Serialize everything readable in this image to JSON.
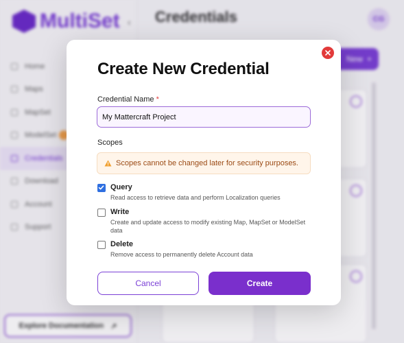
{
  "app": {
    "brand": "MultiSet",
    "page_title": "Credentials",
    "avatar_initials": "CG",
    "new_button_label": "New",
    "explore_label": "Explore Documentation",
    "nav": [
      {
        "label": "Home",
        "icon": "home-icon"
      },
      {
        "label": "Maps",
        "icon": "map-icon"
      },
      {
        "label": "MapSet",
        "icon": "mapset-icon"
      },
      {
        "label": "ModelSet",
        "icon": "modelset-icon"
      },
      {
        "label": "Credentials",
        "icon": "key-icon",
        "active": true
      },
      {
        "label": "Download",
        "icon": "download-icon"
      },
      {
        "label": "Account",
        "icon": "account-icon"
      },
      {
        "label": "Support",
        "icon": "support-icon"
      }
    ]
  },
  "modal": {
    "title": "Create New Credential",
    "name_label": "Credential Name",
    "required_marker": "*",
    "name_value": "My Mattercraft Project",
    "scopes_label": "Scopes",
    "warning_text": "Scopes cannot be changed later for security purposes.",
    "scopes": [
      {
        "name": "Query",
        "checked": true,
        "description": "Read access to retrieve data and perform Localization queries"
      },
      {
        "name": "Write",
        "checked": false,
        "description": "Create and update access to modify existing Map, MapSet or ModelSet data"
      },
      {
        "name": "Delete",
        "checked": false,
        "description": "Remove access to permanently delete Account data"
      }
    ],
    "cancel_label": "Cancel",
    "create_label": "Create"
  },
  "colors": {
    "accent": "#7a2fcc",
    "close": "#e23a3a",
    "checkbox": "#2f6fe0",
    "warning_bg": "#fff5ea",
    "warning_text": "#9a4a14"
  }
}
